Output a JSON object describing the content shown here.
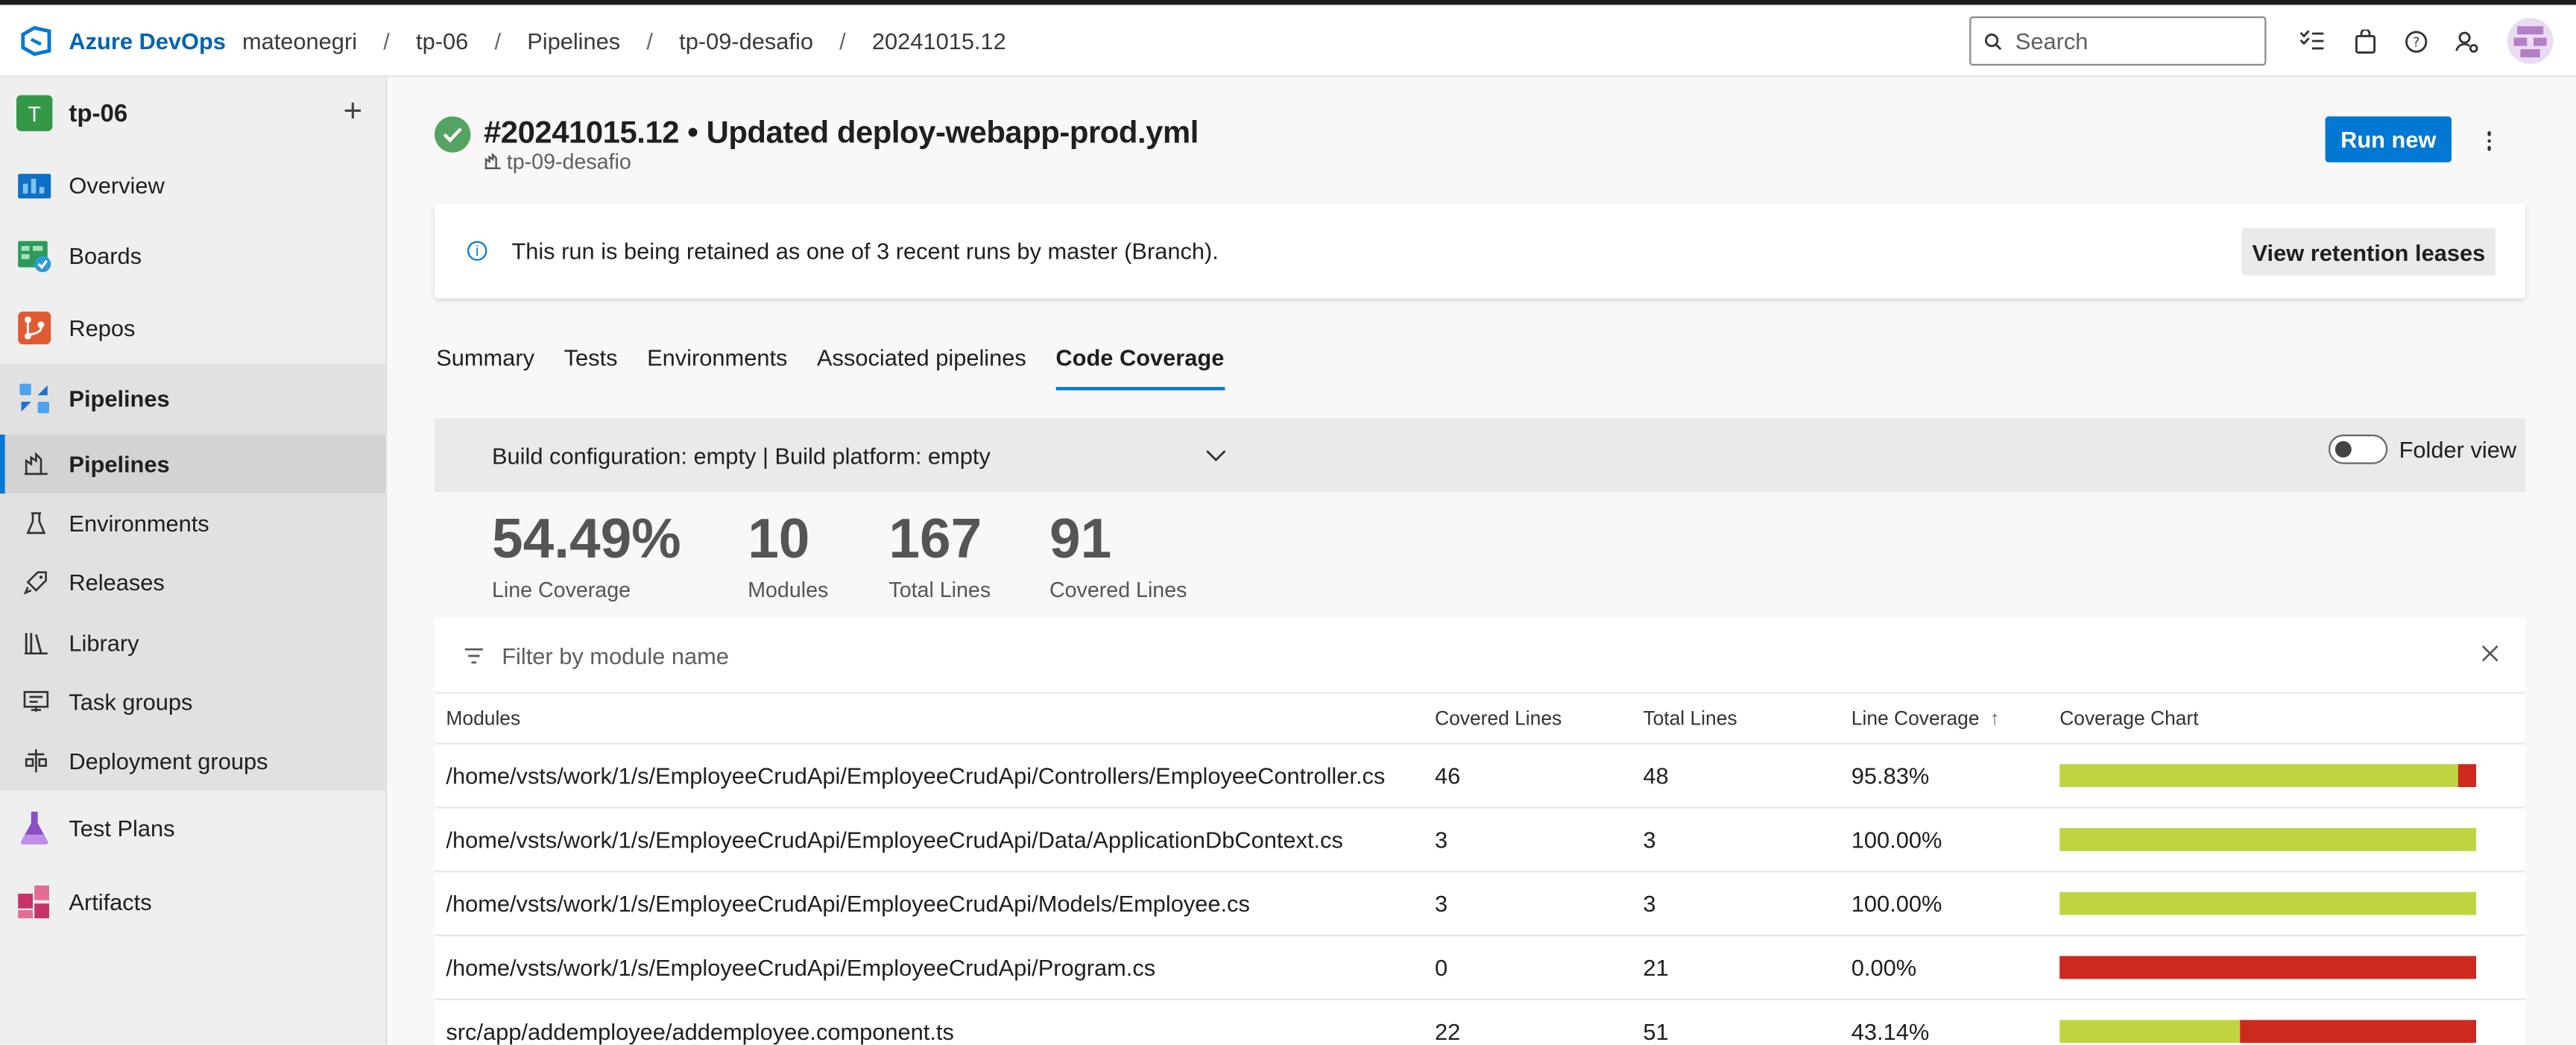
{
  "header": {
    "brand": "Azure DevOps",
    "breadcrumbs": [
      "mateonegri",
      "tp-06",
      "Pipelines",
      "tp-09-desafio",
      "20241015.12"
    ],
    "separator": "/",
    "search_placeholder": "Search"
  },
  "sidebar": {
    "project_initial": "T",
    "project_name": "tp-06",
    "add_label": "+",
    "items": [
      {
        "label": "Overview",
        "icon": "overview-icon"
      },
      {
        "label": "Boards",
        "icon": "boards-icon"
      },
      {
        "label": "Repos",
        "icon": "repos-icon"
      },
      {
        "label": "Pipelines",
        "icon": "pipelines-icon"
      }
    ],
    "pipeline_sub": [
      {
        "label": "Pipelines",
        "icon": "pipeline-sub-icon"
      },
      {
        "label": "Environments",
        "icon": "environments-icon"
      },
      {
        "label": "Releases",
        "icon": "releases-icon"
      },
      {
        "label": "Library",
        "icon": "library-icon"
      },
      {
        "label": "Task groups",
        "icon": "task-groups-icon"
      },
      {
        "label": "Deployment groups",
        "icon": "deployment-groups-icon"
      }
    ],
    "bottom_items": [
      {
        "label": "Test Plans",
        "icon": "test-plans-icon"
      },
      {
        "label": "Artifacts",
        "icon": "artifacts-icon"
      }
    ]
  },
  "run": {
    "title": "#20241015.12 • Updated deploy-webapp-prod.yml",
    "pipeline": "tp-09-desafio",
    "run_new_label": "Run new"
  },
  "banner": {
    "message": "This run is being retained as one of 3 recent runs by master (Branch).",
    "button_label": "View retention leases"
  },
  "tabs": [
    "Summary",
    "Tests",
    "Environments",
    "Associated pipelines",
    "Code Coverage"
  ],
  "active_tab": "Code Coverage",
  "coverage": {
    "config_label": "Build configuration: empty | Build platform: empty",
    "folder_view_label": "Folder view",
    "folder_view_on": false,
    "stats": [
      {
        "value": "54.49%",
        "caption": "Line Coverage"
      },
      {
        "value": "10",
        "caption": "Modules"
      },
      {
        "value": "167",
        "caption": "Total Lines"
      },
      {
        "value": "91",
        "caption": "Covered Lines"
      }
    ],
    "filter_placeholder": "Filter by module name",
    "columns": [
      "Modules",
      "Covered Lines",
      "Total Lines",
      "Line Coverage",
      "Coverage Chart"
    ],
    "sort_indicator": "↑",
    "rows": [
      {
        "module": "/home/vsts/work/1/s/EmployeeCrudApi/EmployeeCrudApi/Controllers/EmployeeController.cs",
        "covered": "46",
        "total": "48",
        "coverage": "95.83%",
        "fraction": 0.9583
      },
      {
        "module": "/home/vsts/work/1/s/EmployeeCrudApi/EmployeeCrudApi/Data/ApplicationDbContext.cs",
        "covered": "3",
        "total": "3",
        "coverage": "100.00%",
        "fraction": 1.0
      },
      {
        "module": "/home/vsts/work/1/s/EmployeeCrudApi/EmployeeCrudApi/Models/Employee.cs",
        "covered": "3",
        "total": "3",
        "coverage": "100.00%",
        "fraction": 1.0
      },
      {
        "module": "/home/vsts/work/1/s/EmployeeCrudApi/EmployeeCrudApi/Program.cs",
        "covered": "0",
        "total": "21",
        "coverage": "0.00%",
        "fraction": 0.0
      },
      {
        "module": "src/app/addemployee/addemployee.component.ts",
        "covered": "22",
        "total": "51",
        "coverage": "43.14%",
        "fraction": 0.4314
      }
    ]
  },
  "colors": {
    "accent": "#0078d4",
    "covered": "#c0d442",
    "uncovered": "#cd2a1d",
    "success": "#55a362"
  }
}
